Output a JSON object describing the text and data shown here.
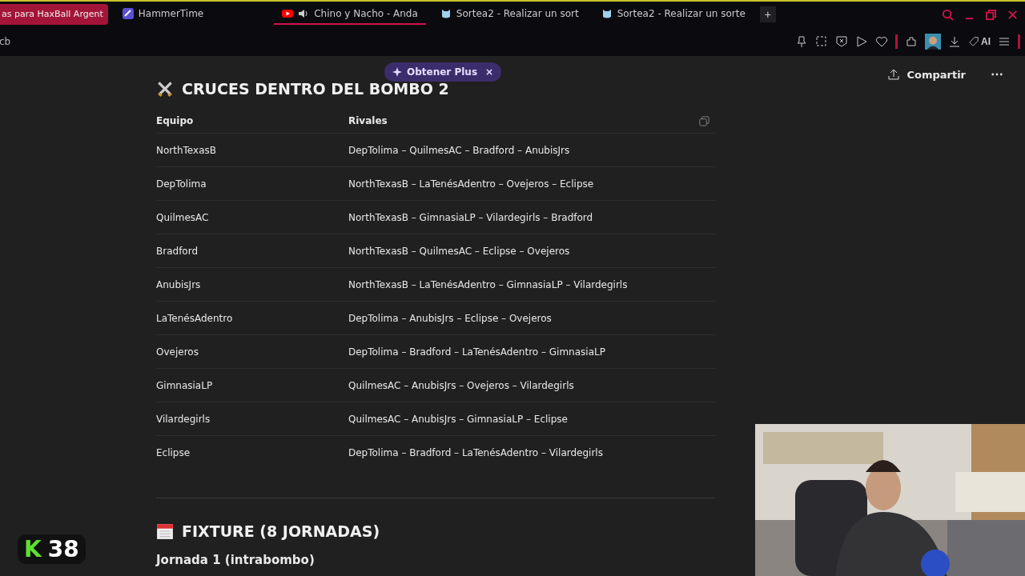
{
  "browser": {
    "tabs": [
      {
        "title": "as para HaxBall Argent",
        "selected": false,
        "highlighted": true,
        "kind": "plain"
      },
      {
        "title": "HammerTime",
        "selected": false,
        "highlighted": false,
        "kind": "app"
      },
      {
        "title": "Chino y Nacho - Anda",
        "selected": true,
        "highlighted": false,
        "kind": "video"
      },
      {
        "title": "Sortea2 - Realizar un sort",
        "selected": false,
        "highlighted": false,
        "kind": "mascot"
      },
      {
        "title": "Sortea2 - Realizar un sorte",
        "selected": false,
        "highlighted": false,
        "kind": "mascot"
      }
    ],
    "new_tab": "+",
    "address": "cb",
    "ai_label": "AI"
  },
  "page": {
    "share_label": "Compartir",
    "promo": {
      "label": "Obtener Plus",
      "close": "×"
    },
    "section_title": "CRUCES DENTRO DEL BOMBO 2",
    "table": {
      "columns": [
        "Equipo",
        "Rivales"
      ],
      "rows": [
        [
          "NorthTexasB",
          "DepTolima – QuilmesAC – Bradford – AnubisJrs"
        ],
        [
          "DepTolima",
          "NorthTexasB – LaTenésAdentro – Ovejeros – Eclipse"
        ],
        [
          "QuilmesAC",
          "NorthTexasB – GimnasiaLP – Vilardegirls – Bradford"
        ],
        [
          "Bradford",
          "NorthTexasB – QuilmesAC – Eclipse – Ovejeros"
        ],
        [
          "AnubisJrs",
          "NorthTexasB – LaTenésAdentro – GimnasiaLP – Vilardegirls"
        ],
        [
          "LaTenésAdentro",
          "DepTolima – AnubisJrs – Eclipse – Ovejeros"
        ],
        [
          "Ovejeros",
          "DepTolima – Bradford – LaTenésAdentro – GimnasiaLP"
        ],
        [
          "GimnasiaLP",
          "QuilmesAC – AnubisJrs – Ovejeros – Vilardegirls"
        ],
        [
          "Vilardegirls",
          "QuilmesAC – AnubisJrs – GimnasiaLP – Eclipse"
        ],
        [
          "Eclipse",
          "DepTolima – Bradford – LaTenésAdentro – Vilardegirls"
        ]
      ]
    },
    "fixture_title": "FIXTURE (8 JORNADAS)",
    "round_title": "Jornada 1 (intrabombo)"
  },
  "overlay": {
    "letter": "K",
    "count": "38"
  }
}
